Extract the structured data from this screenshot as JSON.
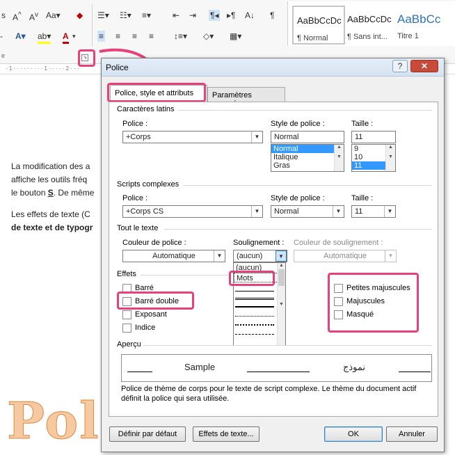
{
  "ribbon": {
    "para_mark": "¶",
    "styles": [
      {
        "preview": "AaBbCcDc",
        "label": "¶ Normal"
      },
      {
        "preview": "AaBbCcDc",
        "label": "¶ Sans int..."
      },
      {
        "preview": "AaBbCc",
        "label": "Titre 1"
      }
    ]
  },
  "doc": {
    "line1": "La modification des a",
    "line2": "affiche les outils fréq",
    "line3a": "le bouton ",
    "line3b": "S",
    "line3c": ". De même",
    "line4a": "Les effets de texte (C",
    "line5": "de texte et de typogr",
    "watermark": "Pol"
  },
  "dialog": {
    "title": "Police",
    "help": "?",
    "close": "✕",
    "tabs": [
      "Police, style et attributs",
      "Paramètres avancés"
    ],
    "latin": {
      "heading": "Caractères latins",
      "police_label": "Police :",
      "police_value": "+Corps",
      "style_label": "Style de police :",
      "style_value": "Normal",
      "style_options": [
        "Normal",
        "Italique",
        "Gras"
      ],
      "size_label": "Taille :",
      "size_value": "11",
      "size_options": [
        "9",
        "10",
        "11"
      ]
    },
    "complex": {
      "heading": "Scripts complexes",
      "police_label": "Police :",
      "police_value": "+Corps CS",
      "style_label": "Style de police :",
      "style_value": "Normal",
      "size_label": "Taille :",
      "size_value": "11"
    },
    "all_text": {
      "heading": "Tout le texte",
      "color_label": "Couleur de police :",
      "color_value": "Automatique",
      "underline_label": "Soulignement :",
      "underline_value": "(aucun)",
      "underline_options": [
        "(aucun)",
        "Mots"
      ],
      "ucolor_label": "Couleur de soulignement :",
      "ucolor_value": "Automatique"
    },
    "effects": {
      "heading": "Effets",
      "left": [
        "Barré",
        "Barré double",
        "Exposant",
        "Indice"
      ],
      "right": [
        "Petites majuscules",
        "Majuscules",
        "Masqué"
      ]
    },
    "preview": {
      "heading": "Aperçu",
      "sample": "Sample",
      "arabic": "نموذج",
      "description": "Police de thème de corps pour le texte de script complexe. Le thème du document actif définit la police qui sera utilisée."
    },
    "buttons": {
      "default": "Définir par défaut",
      "effects": "Effets de texte...",
      "ok": "OK",
      "cancel": "Annuler"
    }
  },
  "colors": {
    "highlight": "#e8417a",
    "accent": "#3399ff"
  }
}
